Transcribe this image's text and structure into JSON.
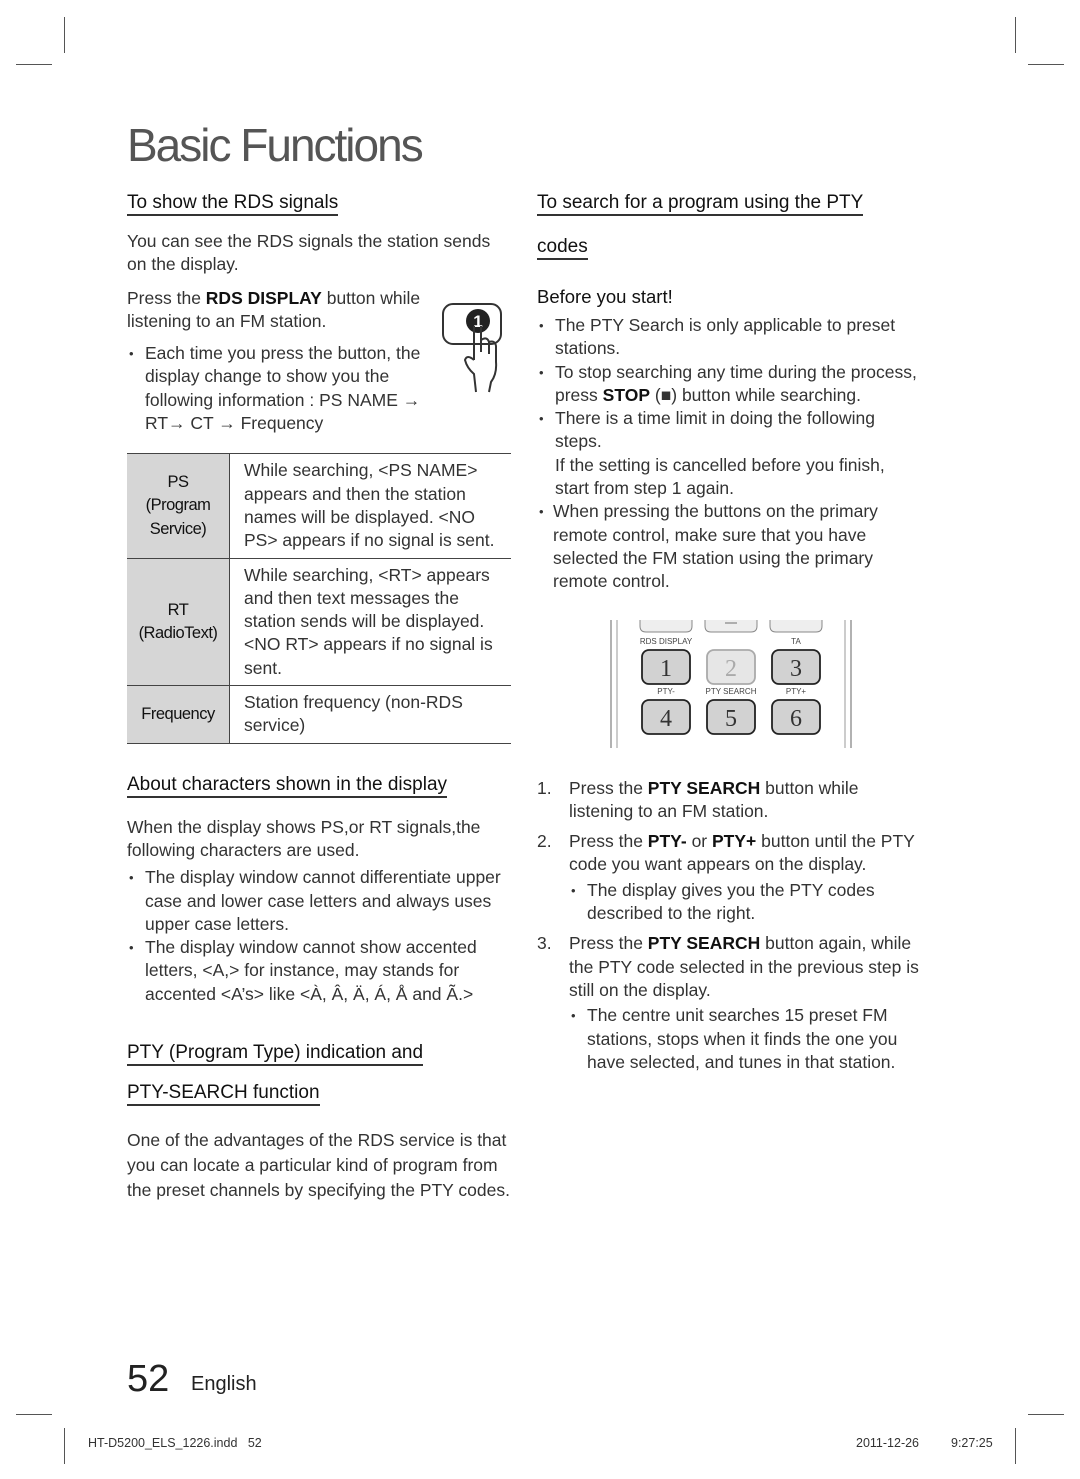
{
  "page": {
    "title": "Basic Functions",
    "page_number": "52",
    "language": "English",
    "slug_file": "HT-D5200_ELS_1226.indd   52",
    "slug_date": "2011-12-26",
    "slug_time": "9:27:25"
  },
  "left": {
    "rds": {
      "heading": "To show the RDS signals",
      "intro": "You can see the RDS signals the station sends on the display.",
      "step_pre": "Press the ",
      "step_bold": "RDS DISPLAY",
      "step_post": " button while listening to an FM station.",
      "step_icon_number": "1",
      "bullet": "Each time you press the button, the display change to show you the following information : PS NAME → RT→ CT → Frequency"
    },
    "table": [
      {
        "key": "PS\n(Program\nService)",
        "value": "While searching, <PS NAME> appears and then the station names will be displayed. <NO PS> appears if no signal is sent."
      },
      {
        "key": "RT\n(RadioText)",
        "value": "While searching, <RT> appears and then text messages the station sends will be displayed. <NO RT> appears if no signal is sent."
      },
      {
        "key": "Frequency",
        "value": "Station frequency (non-RDS service)"
      }
    ],
    "chars": {
      "heading": "About characters shown in the display",
      "intro": "When the display shows PS,or RT signals,the following characters are used.",
      "bullets": [
        "The display window cannot differentiate upper case and lower case letters and always uses upper case letters.",
        "The display window cannot show accented letters, <A,> for instance, may stands for accented <A’s> like <À, Â, Ä, Á, Å and Ã.>"
      ]
    },
    "pty": {
      "heading_line1": "PTY (Program Type) indication and",
      "heading_line2": "PTY-SEARCH function",
      "body": "One of the advantages of the RDS service is that you can locate a particular kind of program from the preset channels by specifying the PTY codes."
    }
  },
  "right": {
    "heading_line1": "To search for a program using the PTY",
    "heading_line2": "codes",
    "before_title": "Before you start!",
    "before_bullets": [
      {
        "text": "The PTY Search is only applicable to preset stations."
      },
      {
        "pre": "To stop searching any time during the process, press ",
        "bold": "STOP",
        "post": " (■) button while searching."
      },
      {
        "text": "There is a time limit in doing the following steps.",
        "extra": "If the setting is cancelled before you finish, start from step 1 again."
      },
      {
        "text": "When pressing the buttons on the primary remote control, make sure that you have selected the FM station using the primary remote control."
      }
    ],
    "remote": {
      "labels_row1": [
        "RDS DISPLAY",
        "",
        "TA"
      ],
      "keys_row1": [
        "1",
        "2",
        "3"
      ],
      "labels_row2": [
        "PTY-",
        "PTY SEARCH",
        "PTY+"
      ],
      "keys_row2": [
        "4",
        "5",
        "6"
      ]
    },
    "steps": [
      {
        "num": "1.",
        "pre": "Press the ",
        "bold": "PTY SEARCH",
        "post": " button while listening to an FM station."
      },
      {
        "num": "2.",
        "pre": "Press the ",
        "bold": "PTY-",
        "mid": " or ",
        "bold2": "PTY+",
        "post": " button until the PTY code you want appears on the display.",
        "sub": "The display gives you the PTY codes described to the right."
      },
      {
        "num": "3.",
        "pre": "Press the ",
        "bold": "PTY SEARCH",
        "post": " button again, while the PTY code selected in the previous step is still on the display.",
        "sub": "The centre unit searches 15 preset FM stations, stops when it finds the one you have selected, and tunes in that station."
      }
    ]
  }
}
